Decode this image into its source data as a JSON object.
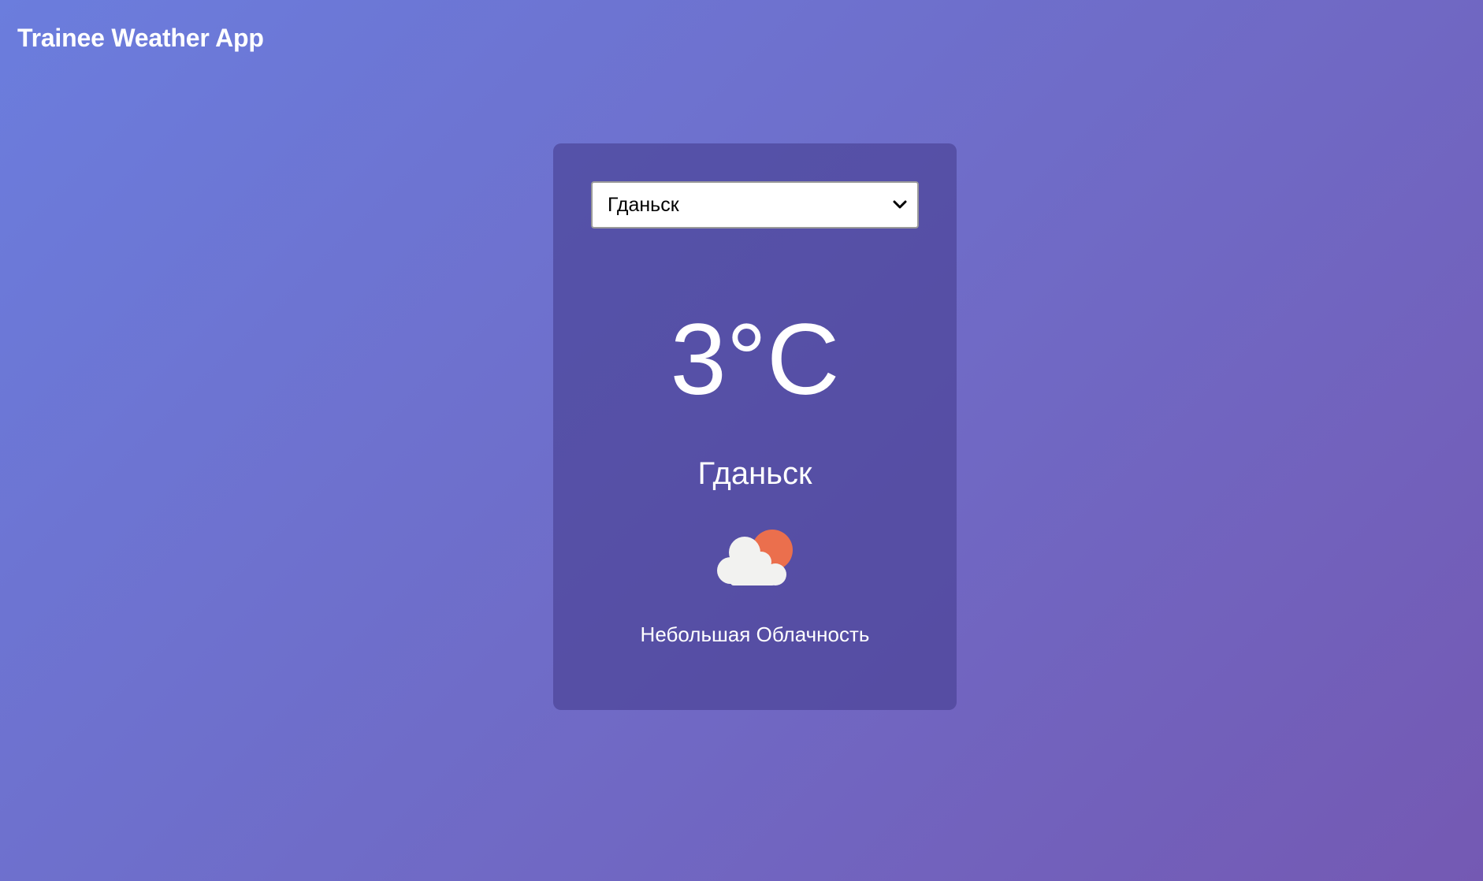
{
  "header": {
    "title": "Trainee Weather App"
  },
  "card": {
    "city_select": {
      "selected": "Гданьск"
    },
    "temperature": "3°C",
    "city": "Гданьск",
    "icon": "partly-cloudy-icon",
    "description": "Небольшая Облачность"
  },
  "colors": {
    "bg_gradient_start": "#6b7ddd",
    "bg_gradient_end": "#7459b3",
    "card_bg": "#5a55a3",
    "sun": "#eb6f4d",
    "cloud": "#f2f2f0"
  }
}
